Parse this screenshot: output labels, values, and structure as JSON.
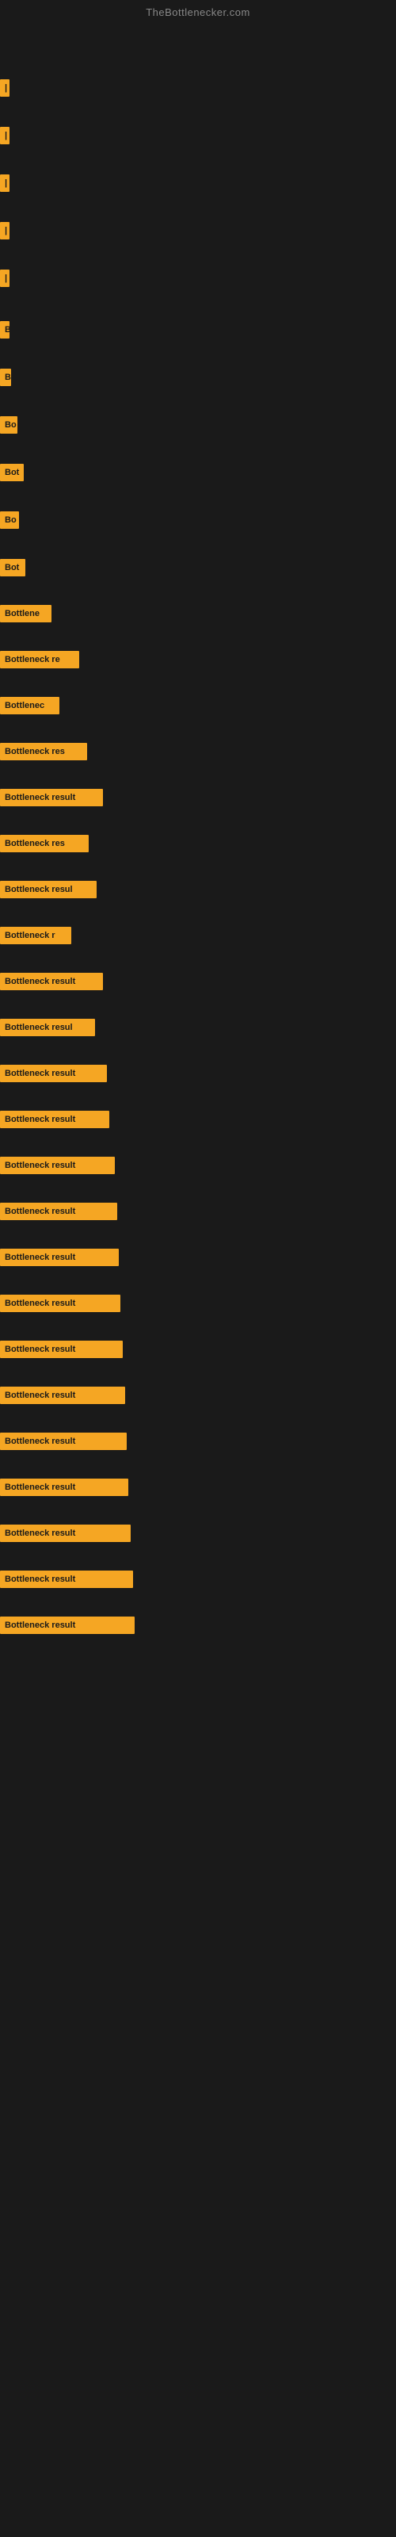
{
  "site": {
    "title": "TheBottlenecker.com"
  },
  "bars": [
    {
      "id": 1,
      "label": "|",
      "width": 6,
      "top_gap": 60
    },
    {
      "id": 2,
      "label": "|",
      "width": 6,
      "top_gap": 30
    },
    {
      "id": 3,
      "label": "|",
      "width": 8,
      "top_gap": 30
    },
    {
      "id": 4,
      "label": "|",
      "width": 6,
      "top_gap": 30
    },
    {
      "id": 5,
      "label": "|",
      "width": 6,
      "top_gap": 30
    },
    {
      "id": 6,
      "label": "B",
      "width": 10,
      "top_gap": 35
    },
    {
      "id": 7,
      "label": "B",
      "width": 14,
      "top_gap": 30
    },
    {
      "id": 8,
      "label": "Bo",
      "width": 22,
      "top_gap": 30
    },
    {
      "id": 9,
      "label": "Bot",
      "width": 30,
      "top_gap": 30
    },
    {
      "id": 10,
      "label": "Bo",
      "width": 24,
      "top_gap": 30
    },
    {
      "id": 11,
      "label": "Bot",
      "width": 32,
      "top_gap": 30
    },
    {
      "id": 12,
      "label": "Bottlene",
      "width": 65,
      "top_gap": 28
    },
    {
      "id": 13,
      "label": "Bottleneck re",
      "width": 100,
      "top_gap": 28
    },
    {
      "id": 14,
      "label": "Bottlenec",
      "width": 75,
      "top_gap": 28
    },
    {
      "id": 15,
      "label": "Bottleneck res",
      "width": 110,
      "top_gap": 28
    },
    {
      "id": 16,
      "label": "Bottleneck result",
      "width": 130,
      "top_gap": 28
    },
    {
      "id": 17,
      "label": "Bottleneck res",
      "width": 112,
      "top_gap": 28
    },
    {
      "id": 18,
      "label": "Bottleneck resul",
      "width": 122,
      "top_gap": 28
    },
    {
      "id": 19,
      "label": "Bottleneck r",
      "width": 90,
      "top_gap": 28
    },
    {
      "id": 20,
      "label": "Bottleneck result",
      "width": 130,
      "top_gap": 28
    },
    {
      "id": 21,
      "label": "Bottleneck resul",
      "width": 120,
      "top_gap": 28
    },
    {
      "id": 22,
      "label": "Bottleneck result",
      "width": 135,
      "top_gap": 28
    },
    {
      "id": 23,
      "label": "Bottleneck result",
      "width": 138,
      "top_gap": 28
    },
    {
      "id": 24,
      "label": "Bottleneck result",
      "width": 145,
      "top_gap": 28
    },
    {
      "id": 25,
      "label": "Bottleneck result",
      "width": 148,
      "top_gap": 28
    },
    {
      "id": 26,
      "label": "Bottleneck result",
      "width": 150,
      "top_gap": 28
    },
    {
      "id": 27,
      "label": "Bottleneck result",
      "width": 152,
      "top_gap": 28
    },
    {
      "id": 28,
      "label": "Bottleneck result",
      "width": 155,
      "top_gap": 28
    },
    {
      "id": 29,
      "label": "Bottleneck result",
      "width": 158,
      "top_gap": 28
    },
    {
      "id": 30,
      "label": "Bottleneck result",
      "width": 160,
      "top_gap": 28
    },
    {
      "id": 31,
      "label": "Bottleneck result",
      "width": 162,
      "top_gap": 28
    },
    {
      "id": 32,
      "label": "Bottleneck result",
      "width": 165,
      "top_gap": 28
    },
    {
      "id": 33,
      "label": "Bottleneck result",
      "width": 168,
      "top_gap": 28
    },
    {
      "id": 34,
      "label": "Bottleneck result",
      "width": 170,
      "top_gap": 28
    }
  ]
}
